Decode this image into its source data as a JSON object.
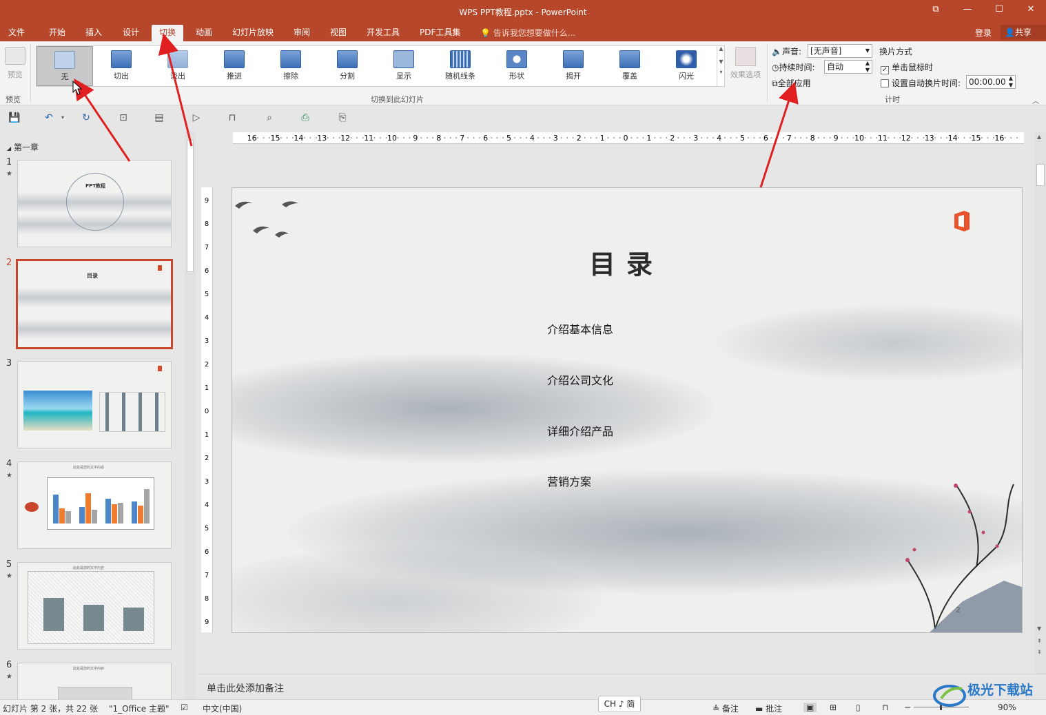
{
  "window": {
    "title": "WPS PPT教程.pptx - PowerPoint",
    "controls": {
      "restore": "⧉",
      "minimize": "—",
      "maximize": "☐",
      "close": "✕"
    }
  },
  "tabs": [
    "文件",
    "开始",
    "插入",
    "设计",
    "切换",
    "动画",
    "幻灯片放映",
    "审阅",
    "视图",
    "开发工具",
    "PDF工具集"
  ],
  "active_tab": "切换",
  "tell_me": "告诉我您想要做什么...",
  "account": {
    "login": "登录",
    "share": "共享"
  },
  "ribbon": {
    "preview_label": "预览",
    "preview_group": "预览",
    "transitions": [
      "无",
      "切出",
      "淡出",
      "推进",
      "擦除",
      "分割",
      "显示",
      "随机线条",
      "形状",
      "揭开",
      "覆盖",
      "闪光"
    ],
    "selected_transition": "无",
    "gallery_group": "切换到此幻灯片",
    "effect_options": "效果选项",
    "sound_label": "声音:",
    "sound_value": "[无声音]",
    "duration_label": "持续时间:",
    "duration_value": "自动",
    "apply_all": "全部应用",
    "advance_label": "换片方式",
    "on_click": "单击鼠标时",
    "on_click_checked": true,
    "auto_after": "设置自动换片时间:",
    "auto_after_value": "00:00.00",
    "timing_group": "计时"
  },
  "thumbnails": {
    "section": "第一章",
    "slides": [
      {
        "num": "1",
        "star": "★",
        "title": "PPT教程"
      },
      {
        "num": "2",
        "star": "",
        "title": "目录"
      },
      {
        "num": "3",
        "star": "",
        "title": ""
      },
      {
        "num": "4",
        "star": "★",
        "title": "此处是您的文字内容"
      },
      {
        "num": "5",
        "star": "★",
        "title": "此处是您的文字内容"
      },
      {
        "num": "6",
        "star": "★",
        "title": "此处是您的文字内容"
      }
    ],
    "current": "2"
  },
  "slide": {
    "title": "目录",
    "items": [
      "介绍基本信息",
      "介绍公司文化",
      "详细介绍产品",
      "营销方案"
    ],
    "page_number": "2"
  },
  "notes_placeholder": "单击此处添加备注",
  "status": {
    "slide_info": "幻灯片 第 2 张，共 22 张",
    "theme": "\"1_Office 主题\"",
    "language": "中文(中国)",
    "notes": "备注",
    "comments": "批注",
    "zoom": "90%",
    "ime": "CH ♪ 简"
  },
  "watermark": "极光下载站",
  "colors": {
    "accent": "#b7472a",
    "arrow": "#e02020"
  }
}
